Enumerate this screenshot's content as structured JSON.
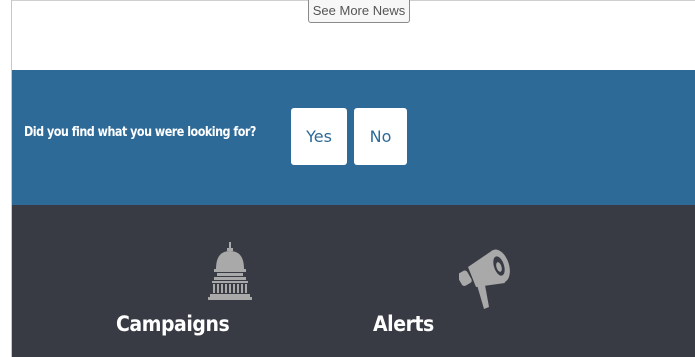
{
  "top": {
    "see_more_label": "See More News"
  },
  "feedback": {
    "question": "Did you find what you were looking for?",
    "yes_label": "Yes",
    "no_label": "No",
    "background_color": "#2d6a98"
  },
  "footer": {
    "background_color": "#383b44",
    "items": [
      {
        "label": "Campaigns",
        "icon": "capitol-icon"
      },
      {
        "label": "Alerts",
        "icon": "megaphone-icon"
      }
    ]
  }
}
